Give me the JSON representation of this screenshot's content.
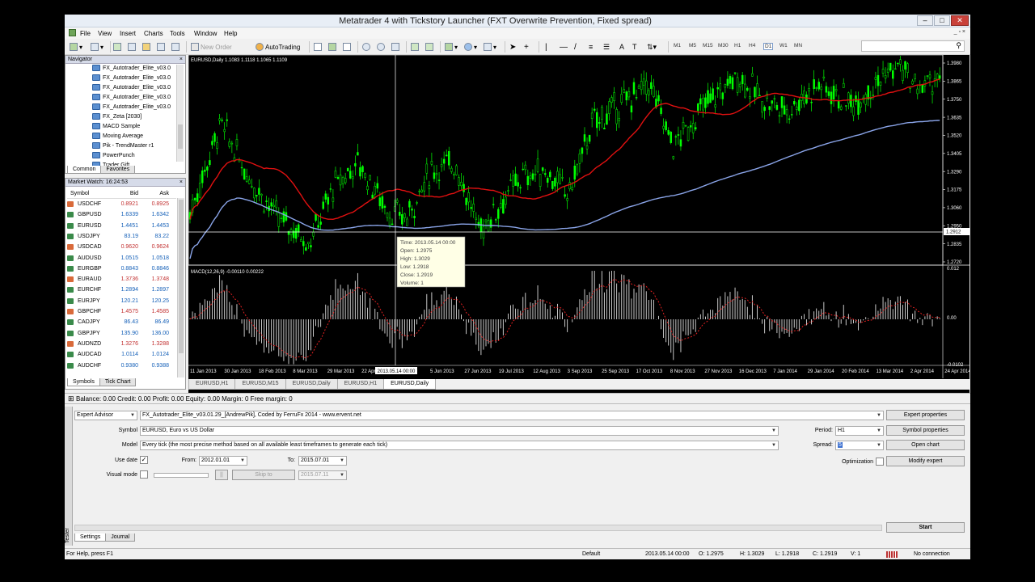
{
  "window": {
    "title": "Metatrader 4 with Tickstory Launcher (FXT Overwrite Prevention, Fixed spread)"
  },
  "menu": [
    "File",
    "View",
    "Insert",
    "Charts",
    "Tools",
    "Window",
    "Help"
  ],
  "toolbar": {
    "new_order": "New Order",
    "auto_trading": "AutoTrading",
    "timeframes": [
      "M1",
      "M5",
      "M15",
      "M30",
      "H1",
      "H4",
      "D1",
      "W1",
      "MN"
    ],
    "active_timeframe": "D1"
  },
  "navigator": {
    "title": "Navigator",
    "items": [
      "FX_Autotrader_Elite_v03.0",
      "FX_Autotrader_Elite_v03.0",
      "FX_Autotrader_Elite_v03.0",
      "FX_Autotrader_Elite_v03.0",
      "FX_Autotrader_Elite_v03.0",
      "FX_Zeta [2030]",
      "MACD Sample",
      "Moving Average",
      "Pik - TrendMaster r1",
      "PowerPunch",
      "Trader Gift"
    ],
    "tabs": [
      "Common",
      "Favorites"
    ]
  },
  "market_watch": {
    "title": "Market Watch: 16:24:53",
    "headers": {
      "symbol": "Symbol",
      "bid": "Bid",
      "ask": "Ask"
    },
    "rows": [
      {
        "symbol": "USDCHF",
        "bid": "0.8921",
        "ask": "0.8925",
        "dir": "down"
      },
      {
        "symbol": "GBPUSD",
        "bid": "1.6339",
        "ask": "1.6342",
        "dir": "up"
      },
      {
        "symbol": "EURUSD",
        "bid": "1.4451",
        "ask": "1.4453",
        "dir": "up"
      },
      {
        "symbol": "USDJPY",
        "bid": "83.19",
        "ask": "83.22",
        "dir": "up"
      },
      {
        "symbol": "USDCAD",
        "bid": "0.9620",
        "ask": "0.9624",
        "dir": "down"
      },
      {
        "symbol": "AUDUSD",
        "bid": "1.0515",
        "ask": "1.0518",
        "dir": "up"
      },
      {
        "symbol": "EURGBP",
        "bid": "0.8843",
        "ask": "0.8846",
        "dir": "up"
      },
      {
        "symbol": "EURAUD",
        "bid": "1.3736",
        "ask": "1.3748",
        "dir": "down"
      },
      {
        "symbol": "EURCHF",
        "bid": "1.2894",
        "ask": "1.2897",
        "dir": "up"
      },
      {
        "symbol": "EURJPY",
        "bid": "120.21",
        "ask": "120.25",
        "dir": "up"
      },
      {
        "symbol": "GBPCHF",
        "bid": "1.4575",
        "ask": "1.4585",
        "dir": "down"
      },
      {
        "symbol": "CADJPY",
        "bid": "86.43",
        "ask": "86.49",
        "dir": "up"
      },
      {
        "symbol": "GBPJPY",
        "bid": "135.90",
        "ask": "136.00",
        "dir": "up"
      },
      {
        "symbol": "AUDNZD",
        "bid": "1.3276",
        "ask": "1.3288",
        "dir": "down"
      },
      {
        "symbol": "AUDCAD",
        "bid": "1.0114",
        "ask": "1.0124",
        "dir": "up"
      },
      {
        "symbol": "AUDCHF",
        "bid": "0.9380",
        "ask": "0.9388",
        "dir": "up"
      }
    ],
    "tabs": [
      "Symbols",
      "Tick Chart"
    ]
  },
  "chart": {
    "header": "EURUSD,Daily  1.1083 1.1118 1.1065 1.1109",
    "macd_header": "MACD(12,26,9) -0.00110 0.00222",
    "price_labels": [
      "1.3980",
      "1.3865",
      "1.3750",
      "1.3635",
      "1.3520",
      "1.3405",
      "1.3290",
      "1.3175",
      "1.3060",
      "1.2950",
      "1.2835",
      "1.2720"
    ],
    "current_price": "1.2912",
    "macd_labels": [
      "0.012",
      "0.00",
      "-0.0102"
    ],
    "date_labels": [
      "11 Jan 2013",
      "30 Jan 2013",
      "18 Feb 2013",
      "8 Mar 2013",
      "29 Mar 2013",
      "22 Apr 2013",
      "2013.05.14 00:00",
      "5 Jun 2013",
      "27 Jun 2013",
      "19 Jul 2013",
      "12 Aug 2013",
      "3 Sep 2013",
      "25 Sep 2013",
      "17 Oct 2013",
      "8 Nov 2013",
      "27 Nov 2013",
      "16 Dec 2013",
      "7 Jan 2014",
      "29 Jan 2014",
      "20 Feb 2014",
      "13 Mar 2014",
      "2 Apr 2014",
      "24 Apr 2014"
    ],
    "tooltip": [
      "Time: 2013.05.14 00:00",
      "Open: 1.2975",
      "High: 1.3029",
      "Low: 1.2918",
      "Close: 1.2919",
      "Volume: 1"
    ],
    "candle_up": "#00ff00",
    "ma_fast": "#e01010",
    "ma_slow": "#8aa4e8"
  },
  "chart_tabs": [
    "EURUSD,H1",
    "EURUSD,M15",
    "EURUSD,Daily",
    "EURUSD,H1",
    "EURUSD,Daily"
  ],
  "account_status": "Balance: 0.00  Credit: 0.00  Profit: 0.00  Equity: 0.00  Margin: 0  Free margin: 0",
  "tester": {
    "mode": "Expert Advisor",
    "expert": "FX_Autotrader_Elite_v03.01.29_[AndrewPik], Coded by FerruFx 2014 - www.ervent.net",
    "symbol_label": "Symbol",
    "symbol": "EURUSD, Euro vs US Dollar",
    "model_label": "Model",
    "model": "Every tick (the most precise method based on all available least timeframes to generate each tick)",
    "use_date_label": "Use date",
    "from_label": "From:",
    "from": "2012.01.01",
    "to_label": "To:",
    "to": "2015.07.01",
    "visual_label": "Visual mode",
    "skip_to": "Skip to",
    "skip_date": "2015.07.11",
    "pause": "||",
    "period_label": "Period:",
    "period": "H1",
    "spread_label": "Spread:",
    "spread": "5",
    "optimization_label": "Optimization",
    "buttons": {
      "expert_props": "Expert properties",
      "symbol_props": "Symbol properties",
      "open_chart": "Open chart",
      "modify_expert": "Modify expert",
      "start": "Start"
    },
    "tabs": [
      "Settings",
      "Journal"
    ],
    "side_label": "Tester"
  },
  "statusbar": {
    "help": "For Help, press F1",
    "profile": "Default",
    "time": "2013.05.14 00:00",
    "o": "O: 1.2975",
    "h": "H: 1.3029",
    "l": "L: 1.2918",
    "c": "C: 1.2919",
    "v": "V: 1",
    "conn": "No connection"
  }
}
